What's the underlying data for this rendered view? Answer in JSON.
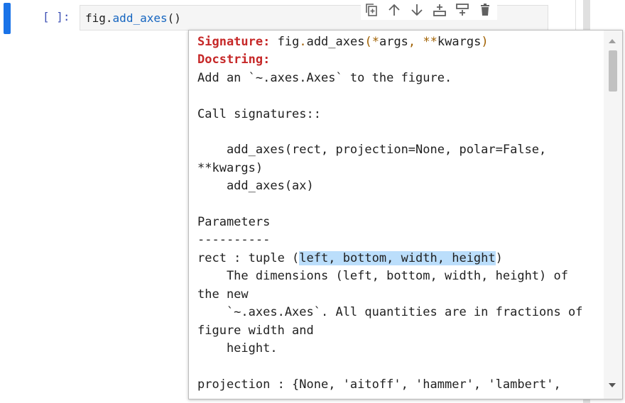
{
  "cell": {
    "prompt": "[ ]:",
    "code_obj": "fig",
    "code_dot": ".",
    "code_fn": "add_axes",
    "code_rest": "()"
  },
  "toolbar": {
    "icons": [
      "duplicate-icon",
      "move-up-icon",
      "move-down-icon",
      "insert-above-icon",
      "insert-below-icon",
      "delete-icon"
    ]
  },
  "tooltip": {
    "signature_label": "Signature:",
    "signature_obj": "fig",
    "signature_fn": "add_axes",
    "signature_args_open": "(",
    "signature_args_star": "*",
    "signature_args": "args",
    "signature_comma": ",",
    "signature_kwstar": "**",
    "signature_kwargs": "kwargs",
    "signature_close": ")",
    "docstring_label": "Docstring:",
    "line_1": "Add an `~.axes.Axes` to the figure.",
    "line_2": "",
    "line_3": "Call signatures::",
    "line_4": "",
    "line_5": "    add_axes(rect, projection=None, polar=False,",
    "line_6": "**kwargs)",
    "line_7": "    add_axes(ax)",
    "line_8": "",
    "line_9": "Parameters",
    "line_10": "----------",
    "line_11_pre": "rect : tuple (",
    "line_11_hl": "left, bottom, width, height",
    "line_11_post": ")",
    "line_12": "    The dimensions (left, bottom, width, height) of",
    "line_13": "the new",
    "line_14": "    `~.axes.Axes`. All quantities are in fractions of",
    "line_15": "figure width and",
    "line_16": "    height.",
    "line_17": "",
    "line_18": "projection : {None, 'aitoff', 'hammer', 'lambert',"
  }
}
